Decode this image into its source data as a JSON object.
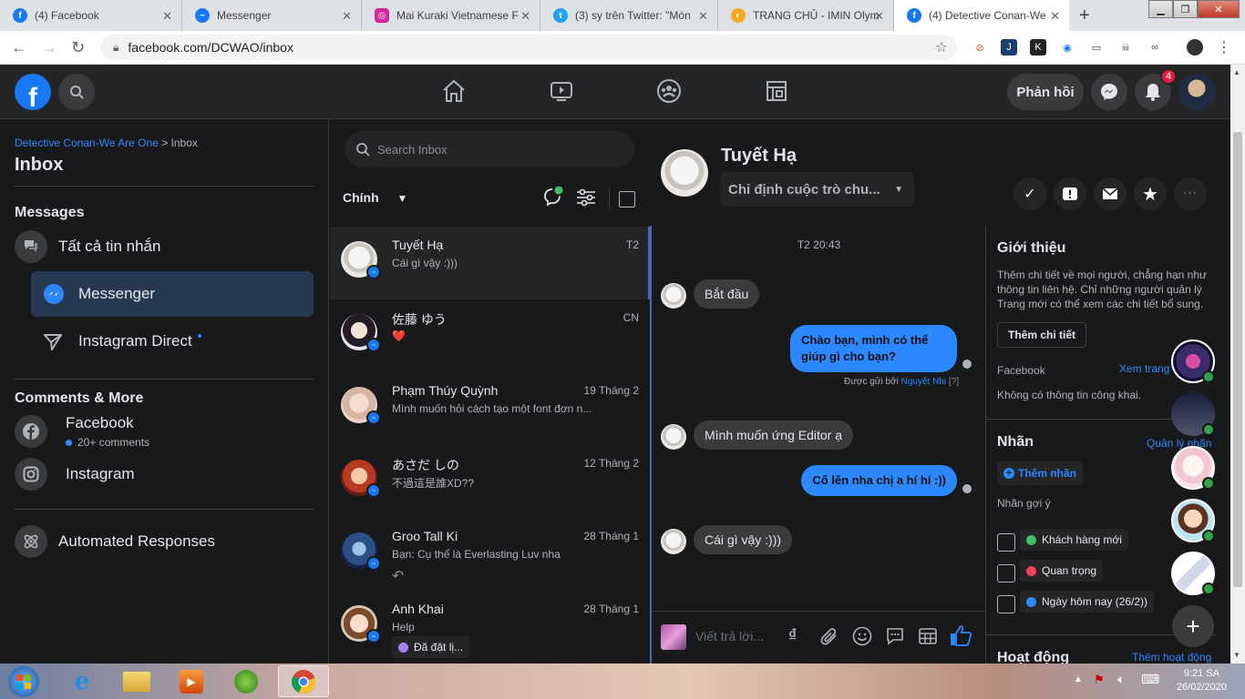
{
  "browser": {
    "tabs": [
      {
        "title": "(4) Facebook",
        "icon": "facebook-icon",
        "color": "#1877f2"
      },
      {
        "title": "Messenger",
        "icon": "messenger-icon",
        "color": "#1877f2"
      },
      {
        "title": "Mai Kuraki Vietnamese F",
        "icon": "instagram-icon",
        "color": "#d6249f"
      },
      {
        "title": "(3) sy trên Twitter: \"Món",
        "icon": "twitter-icon",
        "color": "#1da1f2"
      },
      {
        "title": "TRANG CHỦ - IMIN Olym",
        "icon": "imin-icon",
        "color": "#f5a623"
      },
      {
        "title": "(4) Detective Conan-We",
        "icon": "facebook-icon",
        "color": "#1877f2"
      }
    ],
    "url": "facebook.com/DCWAO/inbox"
  },
  "topbar": {
    "feedback_label": "Phản hồi",
    "notification_count": "4"
  },
  "left": {
    "breadcrumb_page": "Detective Conan-We Are One",
    "breadcrumb_sep": " > ",
    "breadcrumb_current": "Inbox",
    "title": "Inbox",
    "messages_section": "Messages",
    "all_messages": "Tất cả tin nhắn",
    "messenger": "Messenger",
    "instagram_direct": "Instagram Direct",
    "comments_section": "Comments & More",
    "facebook": "Facebook",
    "facebook_sub": "20+ comments",
    "instagram": "Instagram",
    "automated": "Automated Responses"
  },
  "convlist": {
    "search_placeholder": "Search Inbox",
    "filter_label": "Chính",
    "items": [
      {
        "name": "Tuyết Hạ",
        "preview": "Cái gì vậy :)))",
        "date": "T2"
      },
      {
        "name": "佐藤 ゆう",
        "preview": "❤️",
        "date": "CN"
      },
      {
        "name": "Phạm Thúy Quỳnh",
        "preview": "Mình muốn hỏi cách tạo một font đơn n...",
        "date": "19 Tháng 2"
      },
      {
        "name": "あさだ しの",
        "preview": "不過這是誰XD??",
        "date": "12 Tháng 2"
      },
      {
        "name": "Groo Tall Ki",
        "preview": "Bạn: Cụ thể là Everlasting Luv nha",
        "date": "28 Tháng 1"
      },
      {
        "name": "Anh Khai",
        "preview": "Help",
        "date": "28 Tháng 1",
        "tag": "Đã đặt lị..."
      }
    ]
  },
  "chat": {
    "name": "Tuyết Hạ",
    "assign_placeholder": "Chỉ định cuộc trò chu...",
    "timestamp": "T2 20:43",
    "messages": [
      {
        "dir": "in",
        "text": "Bắt đầu"
      },
      {
        "dir": "out",
        "text": "Chào bạn, mình có thể giúp gì cho bạn?"
      },
      {
        "dir": "in",
        "text": "Mình muốn ứng Editor ạ"
      },
      {
        "dir": "out",
        "text": "Cố lên nha chị a hí hí :))"
      },
      {
        "dir": "in",
        "text": "Cái gì vậy :)))"
      }
    ],
    "sent_by_prefix": "Được gửi bởi ",
    "sent_by_name": "Nguyệt Nhi",
    "sent_by_help": "[?]",
    "composer_placeholder": "Viết trả lời..."
  },
  "info": {
    "about_title": "Giới thiệu",
    "about_text": "Thêm chi tiết về mọi người, chẳng hạn như thông tin liên hệ. Chỉ những người quản lý Trang mới có thể xem các chi tiết bổ sung.",
    "add_details": "Thêm chi tiết",
    "facebook_label": "Facebook",
    "view_page": "Xem trang",
    "no_public": "Không có thông tin công khai.",
    "labels_title": "Nhãn",
    "manage_labels": "Quản lý nhãn",
    "add_label": "Thêm nhãn",
    "suggested": "Nhãn gợi ý",
    "suggested_labels": [
      {
        "text": "Khách hàng mới",
        "color": "#45bd62"
      },
      {
        "text": "Quan trọng",
        "color": "#f3425f"
      },
      {
        "text": "Ngày hôm nay (26/2))",
        "color": "#2d88ff"
      }
    ],
    "activity_title": "Hoạt động",
    "add_activity": "Thêm hoạt động"
  },
  "taskbar": {
    "time": "9:21 SA",
    "date": "26/02/2020"
  },
  "colors": {
    "accent": "#2d88ff",
    "fb_blue": "#1877f2",
    "bg": "#18191a",
    "surface": "#242526"
  }
}
